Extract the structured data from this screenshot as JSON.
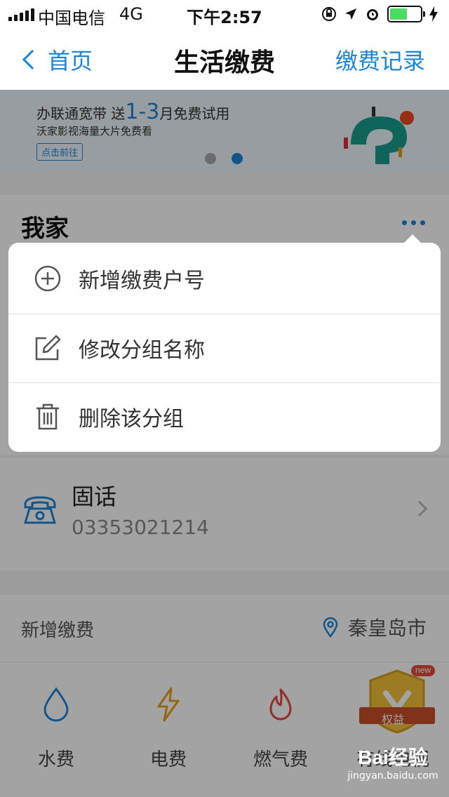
{
  "status_bar": {
    "carrier": "中国电信",
    "network": "4G",
    "time": "下午2:57"
  },
  "nav": {
    "back_label": "首页",
    "title": "生活缴费",
    "right_label": "缴费记录"
  },
  "banner": {
    "line1_prefix": "办联通宽带  送",
    "line1_highlight": "1-3",
    "line1_suffix": "月免费试用",
    "line2": "沃家影视海量大片免费看",
    "button": "点击前往",
    "active_dot": 2,
    "dot_count": 2
  },
  "group": {
    "title": "我家"
  },
  "menu": {
    "items": [
      {
        "label": "新增缴费户号",
        "icon": "add-circle-icon"
      },
      {
        "label": "修改分组名称",
        "icon": "edit-icon"
      },
      {
        "label": "删除该分组",
        "icon": "trash-icon"
      }
    ]
  },
  "account": {
    "title": "固话",
    "number": "03353021214",
    "icon": "telephone-icon"
  },
  "add_payment": {
    "label": "新增缴费",
    "city": "秦皇岛市"
  },
  "services": [
    {
      "label": "水费",
      "icon": "water-drop-icon"
    },
    {
      "label": "电费",
      "icon": "lightning-icon"
    },
    {
      "label": "燃气费",
      "icon": "flame-icon"
    },
    {
      "label": "有线电视",
      "icon": "tv-icon"
    }
  ],
  "promo_badge": {
    "tag": "new",
    "label": "权益"
  },
  "watermark": {
    "logo": "Bai经验",
    "url": "jingyan.baidu.com"
  },
  "colors": {
    "accent": "#1b86d9",
    "overlay": "rgba(0,0,0,0.36)",
    "battery": "#4cd964"
  }
}
